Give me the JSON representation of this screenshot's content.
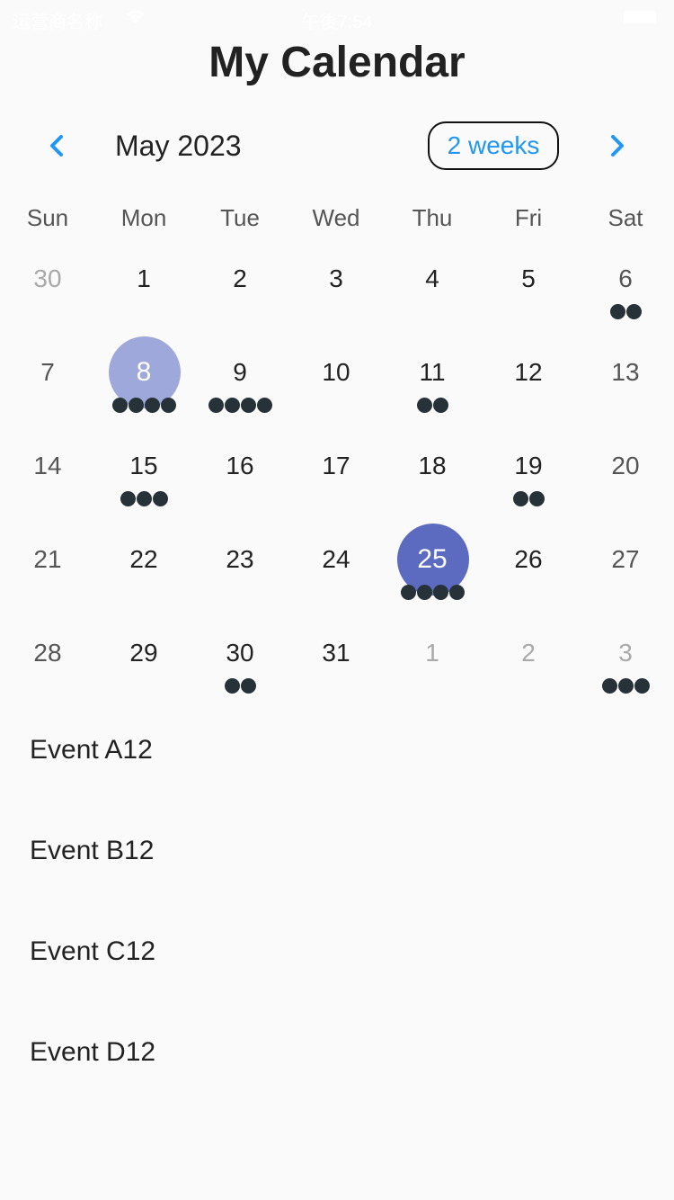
{
  "status_bar": {
    "carrier": "运营商名称",
    "time": "午後7:54"
  },
  "title": "My Calendar",
  "header": {
    "month": "May 2023",
    "format_button": "2 weeks",
    "prev_icon": "chevron-left-icon",
    "next_icon": "chevron-right-icon",
    "accent_color": "#2196f3"
  },
  "weekdays": [
    "Sun",
    "Mon",
    "Tue",
    "Wed",
    "Thu",
    "Fri",
    "Sat"
  ],
  "weeks": [
    [
      {
        "day": "30",
        "outside": true,
        "markers": 0
      },
      {
        "day": "1",
        "markers": 0
      },
      {
        "day": "2",
        "markers": 0
      },
      {
        "day": "3",
        "markers": 0
      },
      {
        "day": "4",
        "markers": 0
      },
      {
        "day": "5",
        "markers": 0
      },
      {
        "day": "6",
        "markers": 2
      }
    ],
    [
      {
        "day": "7",
        "markers": 0
      },
      {
        "day": "8",
        "markers": 4,
        "state": "today"
      },
      {
        "day": "9",
        "markers": 4
      },
      {
        "day": "10",
        "markers": 0
      },
      {
        "day": "11",
        "markers": 2
      },
      {
        "day": "12",
        "markers": 0
      },
      {
        "day": "13",
        "markers": 0
      }
    ],
    [
      {
        "day": "14",
        "markers": 0
      },
      {
        "day": "15",
        "markers": 3
      },
      {
        "day": "16",
        "markers": 0
      },
      {
        "day": "17",
        "markers": 0
      },
      {
        "day": "18",
        "markers": 0
      },
      {
        "day": "19",
        "markers": 2
      },
      {
        "day": "20",
        "markers": 0
      }
    ],
    [
      {
        "day": "21",
        "markers": 0
      },
      {
        "day": "22",
        "markers": 0
      },
      {
        "day": "23",
        "markers": 0
      },
      {
        "day": "24",
        "markers": 0
      },
      {
        "day": "25",
        "markers": 4,
        "state": "selected"
      },
      {
        "day": "26",
        "markers": 0
      },
      {
        "day": "27",
        "markers": 0
      }
    ],
    [
      {
        "day": "28",
        "markers": 0
      },
      {
        "day": "29",
        "markers": 0
      },
      {
        "day": "30",
        "markers": 2
      },
      {
        "day": "31",
        "markers": 0
      },
      {
        "day": "1",
        "outside": true,
        "markers": 0
      },
      {
        "day": "2",
        "outside": true,
        "markers": 0
      },
      {
        "day": "3",
        "outside": true,
        "markers": 3
      }
    ]
  ],
  "colors": {
    "selected": "#5c6bc0",
    "today": "#9fa8da",
    "marker": "#263238",
    "outside_text": "#a9a9a9"
  },
  "events": [
    "Event A12",
    "Event B12",
    "Event C12",
    "Event D12"
  ]
}
